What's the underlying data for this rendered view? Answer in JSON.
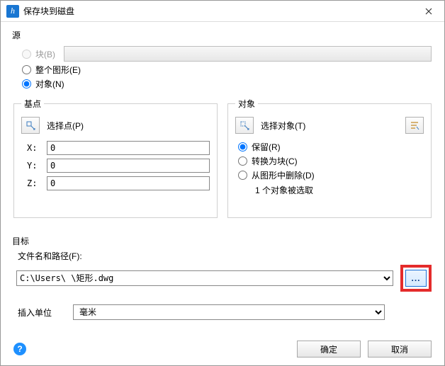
{
  "window": {
    "title": "保存块到磁盘"
  },
  "source": {
    "legend": "源",
    "block_label": "块(B)",
    "entire_label": "整个图形(E)",
    "objects_label": "对象(N)",
    "selected": "objects"
  },
  "basepoint": {
    "legend": "基点",
    "pick_label": "选择点(P)",
    "x_label": "X:",
    "y_label": "Y:",
    "z_label": "Z:",
    "x": "0",
    "y": "0",
    "z": "0"
  },
  "objects": {
    "legend": "对象",
    "select_label": "选择对象(T)",
    "retain_label": "保留(R)",
    "convert_label": "转换为块(C)",
    "delete_label": "从图形中删除(D)",
    "count_text": "1 个对象被选取",
    "selected": "retain"
  },
  "target": {
    "legend": "目标",
    "path_label": "文件名和路径(F):",
    "path_value": "C:\\Users\\        \\矩形.dwg",
    "unit_label": "插入单位",
    "unit_value": "毫米"
  },
  "footer": {
    "ok": "确定",
    "cancel": "取消"
  }
}
